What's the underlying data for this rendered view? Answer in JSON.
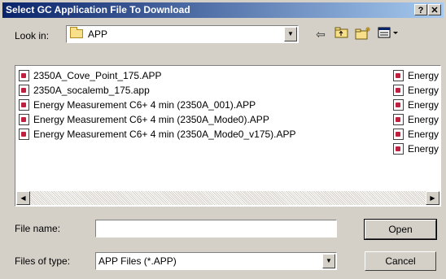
{
  "window": {
    "title": "Select GC Application File To Download",
    "help_label": "?",
    "close_label": "✕"
  },
  "lookin": {
    "label": "Look in:",
    "value": "APP"
  },
  "files": {
    "column1": [
      "2350A_Cove_Point_175.APP",
      "2350A_socalemb_175.app",
      "Energy Measurement C6+ 4 min (2350A_001).APP",
      "Energy Measurement C6+ 4 min (2350A_Mode0).APP",
      "Energy Measurement C6+ 4 min (2350A_Mode0_v175).APP"
    ],
    "column2": [
      "Energy",
      "Energy",
      "Energy",
      "Energy",
      "Energy",
      "Energy"
    ]
  },
  "filename": {
    "label": "File name:",
    "value": ""
  },
  "filetype": {
    "label": "Files of type:",
    "value": "APP Files (*.APP)"
  },
  "buttons": {
    "open": "Open",
    "cancel": "Cancel"
  }
}
